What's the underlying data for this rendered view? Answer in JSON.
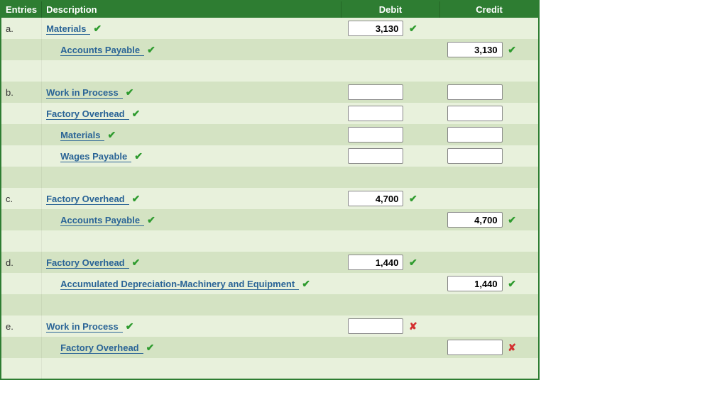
{
  "headers": {
    "entries": "Entries",
    "description": "Description",
    "debit": "Debit",
    "credit": "Credit"
  },
  "rows": [
    {
      "entry": "a.",
      "shade": "light",
      "account": "Materials",
      "indent": false,
      "acctMark": "check",
      "debit": "3,130",
      "debitMark": "check",
      "credit": "",
      "creditMark": ""
    },
    {
      "entry": "",
      "shade": "dark",
      "account": "Accounts Payable",
      "indent": true,
      "acctMark": "check",
      "debit": "",
      "debitMark": "",
      "credit": "3,130",
      "creditMark": "check"
    },
    {
      "entry": "",
      "shade": "light",
      "account": "",
      "indent": false,
      "acctMark": "",
      "debit": "",
      "debitMark": "",
      "credit": "",
      "creditMark": "",
      "spacer": true
    },
    {
      "entry": "b.",
      "shade": "dark",
      "account": "Work in Process",
      "indent": false,
      "acctMark": "check",
      "debit": "",
      "debitMark": "none",
      "credit": "",
      "creditMark": "none"
    },
    {
      "entry": "",
      "shade": "light",
      "account": "Factory Overhead",
      "indent": false,
      "acctMark": "check",
      "debit": "",
      "debitMark": "none",
      "credit": "",
      "creditMark": "none"
    },
    {
      "entry": "",
      "shade": "dark",
      "account": "Materials",
      "indent": true,
      "acctMark": "check",
      "debit": "",
      "debitMark": "none",
      "credit": "",
      "creditMark": "none"
    },
    {
      "entry": "",
      "shade": "light",
      "account": "Wages Payable",
      "indent": true,
      "acctMark": "check",
      "debit": "",
      "debitMark": "none",
      "credit": "",
      "creditMark": "none"
    },
    {
      "entry": "",
      "shade": "dark",
      "account": "",
      "indent": false,
      "acctMark": "",
      "debit": "",
      "debitMark": "",
      "credit": "",
      "creditMark": "",
      "spacer": true
    },
    {
      "entry": "c.",
      "shade": "light",
      "account": "Factory Overhead",
      "indent": false,
      "acctMark": "check",
      "debit": "4,700",
      "debitMark": "check",
      "credit": "",
      "creditMark": ""
    },
    {
      "entry": "",
      "shade": "dark",
      "account": "Accounts Payable",
      "indent": true,
      "acctMark": "check",
      "debit": "",
      "debitMark": "",
      "credit": "4,700",
      "creditMark": "check"
    },
    {
      "entry": "",
      "shade": "light",
      "account": "",
      "indent": false,
      "acctMark": "",
      "debit": "",
      "debitMark": "",
      "credit": "",
      "creditMark": "",
      "spacer": true
    },
    {
      "entry": "d.",
      "shade": "dark",
      "account": "Factory Overhead",
      "indent": false,
      "acctMark": "check",
      "debit": "1,440",
      "debitMark": "check",
      "credit": "",
      "creditMark": ""
    },
    {
      "entry": "",
      "shade": "light",
      "account": "Accumulated Depreciation-Machinery and Equipment",
      "indent": true,
      "acctMark": "check",
      "debit": "",
      "debitMark": "",
      "credit": "1,440",
      "creditMark": "check"
    },
    {
      "entry": "",
      "shade": "dark",
      "account": "",
      "indent": false,
      "acctMark": "",
      "debit": "",
      "debitMark": "",
      "credit": "",
      "creditMark": "",
      "spacer": true
    },
    {
      "entry": "e.",
      "shade": "light",
      "account": "Work in Process",
      "indent": false,
      "acctMark": "check",
      "debit": "",
      "debitMark": "cross",
      "credit": "",
      "creditMark": ""
    },
    {
      "entry": "",
      "shade": "dark",
      "account": "Factory Overhead",
      "indent": true,
      "acctMark": "check",
      "debit": "",
      "debitMark": "",
      "credit": "",
      "creditMark": "cross"
    },
    {
      "entry": "",
      "shade": "light",
      "account": "",
      "indent": false,
      "acctMark": "",
      "debit": "",
      "debitMark": "",
      "credit": "",
      "creditMark": "",
      "spacer": true
    }
  ]
}
